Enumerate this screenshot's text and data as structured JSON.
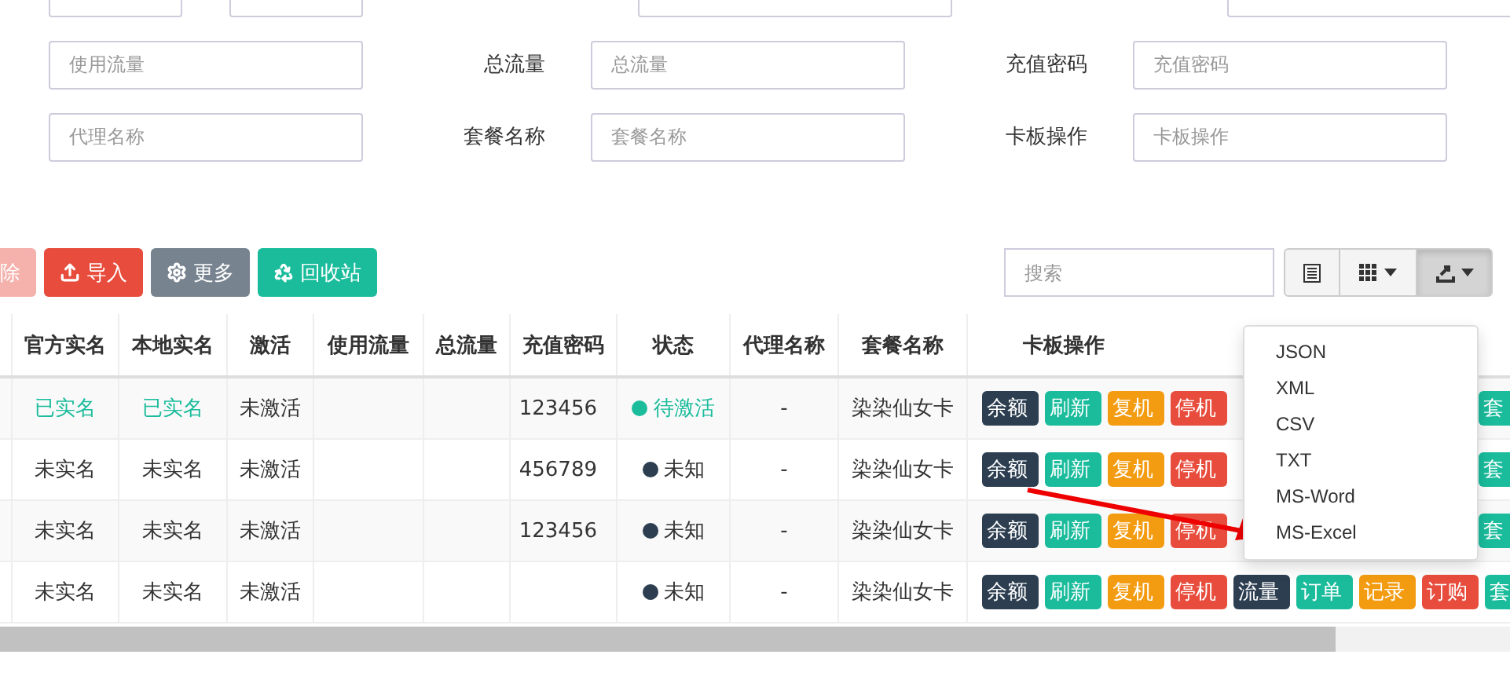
{
  "filters": [
    [
      {
        "placeholder": "使用流量"
      },
      {
        "label": "总流量",
        "placeholder": "总流量"
      },
      {
        "label": "充值密码",
        "placeholder": "充值密码"
      }
    ],
    [
      {
        "placeholder": "代理名称"
      },
      {
        "label": "套餐名称",
        "placeholder": "套餐名称"
      },
      {
        "label": "卡板操作",
        "placeholder": "卡板操作"
      }
    ]
  ],
  "toolbar": [
    {
      "label": "除",
      "kind": "delete",
      "disabled": true
    },
    {
      "label": "导入",
      "kind": "import",
      "disabled": false
    },
    {
      "label": "更多",
      "kind": "more",
      "disabled": false
    },
    {
      "label": "回收站",
      "kind": "recycle",
      "disabled": false
    }
  ],
  "search": {
    "placeholder": "搜索"
  },
  "export_menu": {
    "open": true,
    "items": [
      "JSON",
      "XML",
      "CSV",
      "TXT",
      "MS-Word",
      "MS-Excel"
    ]
  },
  "columns": [
    "官方实名",
    "本地实名",
    "激活",
    "使用流量",
    "总流量",
    "充值密码",
    "状态",
    "代理名称",
    "套餐名称",
    "卡板操作"
  ],
  "rows": [
    {
      "official": {
        "text": "已实名",
        "verified": true
      },
      "local": {
        "text": "已实名",
        "verified": true
      },
      "active": "未激活",
      "recharge": "123456",
      "status": {
        "text": "待激活",
        "color": "#1abc9c"
      },
      "agent": "-",
      "plan": "染染仙女卡",
      "ops": [
        {
          "label": "余额",
          "kind": "dark"
        },
        {
          "label": "刷新",
          "kind": "green"
        },
        {
          "label": "复机",
          "kind": "orange"
        },
        {
          "label": "停机",
          "kind": "red"
        }
      ],
      "tail": {
        "label": "套",
        "kind": "green"
      }
    },
    {
      "official": {
        "text": "未实名",
        "verified": false
      },
      "local": {
        "text": "未实名",
        "verified": false
      },
      "active": "未激活",
      "recharge": "456789",
      "status": {
        "text": "未知",
        "color": "#2c3e50"
      },
      "agent": "-",
      "plan": "染染仙女卡",
      "ops": [
        {
          "label": "余额",
          "kind": "dark"
        },
        {
          "label": "刷新",
          "kind": "green"
        },
        {
          "label": "复机",
          "kind": "orange"
        },
        {
          "label": "停机",
          "kind": "red"
        }
      ],
      "tail": {
        "label": "套",
        "kind": "green"
      }
    },
    {
      "official": {
        "text": "未实名",
        "verified": false
      },
      "local": {
        "text": "未实名",
        "verified": false
      },
      "active": "未激活",
      "recharge": "123456",
      "status": {
        "text": "未知",
        "color": "#2c3e50"
      },
      "agent": "-",
      "plan": "染染仙女卡",
      "ops": [
        {
          "label": "余额",
          "kind": "dark"
        },
        {
          "label": "刷新",
          "kind": "green"
        },
        {
          "label": "复机",
          "kind": "orange"
        },
        {
          "label": "停机",
          "kind": "red"
        }
      ],
      "tail": {
        "label": "套",
        "kind": "green"
      }
    },
    {
      "official": {
        "text": "未实名",
        "verified": false
      },
      "local": {
        "text": "未实名",
        "verified": false
      },
      "active": "未激活",
      "recharge": "",
      "status": {
        "text": "未知",
        "color": "#2c3e50"
      },
      "agent": "-",
      "plan": "染染仙女卡",
      "ops": [
        {
          "label": "余额",
          "kind": "dark"
        },
        {
          "label": "刷新",
          "kind": "green"
        },
        {
          "label": "复机",
          "kind": "orange"
        },
        {
          "label": "停机",
          "kind": "red"
        },
        {
          "label": "流量",
          "kind": "dark"
        },
        {
          "label": "订单",
          "kind": "green"
        },
        {
          "label": "记录",
          "kind": "orange"
        },
        {
          "label": "订购",
          "kind": "red"
        }
      ],
      "tail": {
        "label": "套",
        "kind": "green"
      }
    }
  ]
}
